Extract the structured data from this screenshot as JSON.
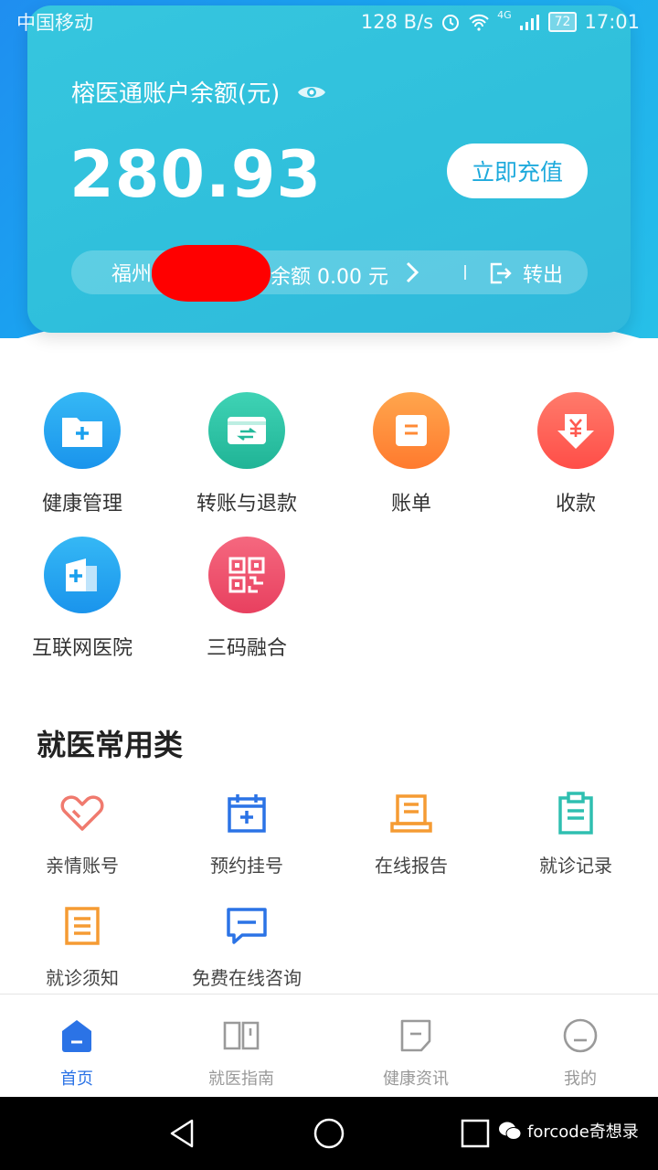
{
  "status_bar": {
    "carrier": "中国移动",
    "speed": "128 B/s",
    "battery": "72",
    "time": "17:01",
    "network": "4G"
  },
  "account": {
    "balance_label": "榕医通账户余额(元)",
    "balance": "280.93",
    "recharge_label": "立即充值",
    "sub_account_name": "福州",
    "sub_account_balance": "余额 0.00 元",
    "transfer_out_label": "转出"
  },
  "main_grid": [
    {
      "label": "健康管理",
      "icon": "health-folder-icon",
      "color": "#1aa4ef"
    },
    {
      "label": "转账与退款",
      "icon": "transfer-icon",
      "color": "#27c3a5"
    },
    {
      "label": "账单",
      "icon": "bill-icon",
      "color": "#ff8f3a"
    },
    {
      "label": "收款",
      "icon": "receive-yuan-icon",
      "color": "#ff5a52"
    },
    {
      "label": "互联网医院",
      "icon": "internet-hospital-icon",
      "color": "#1aa4ef"
    },
    {
      "label": "三码融合",
      "icon": "qr-code-icon",
      "color": "#ef4f6f"
    }
  ],
  "section": {
    "title": "就医常用类",
    "items": [
      {
        "label": "亲情账号",
        "icon": "heart-icon",
        "color": "#f07a6e"
      },
      {
        "label": "预约挂号",
        "icon": "calendar-icon",
        "color": "#2b73e6"
      },
      {
        "label": "在线报告",
        "icon": "report-icon",
        "color": "#f59b33"
      },
      {
        "label": "就诊记录",
        "icon": "clipboard-icon",
        "color": "#2fbfb0"
      },
      {
        "label": "就诊须知",
        "icon": "notice-icon",
        "color": "#f59b33"
      },
      {
        "label": "免费在线咨询",
        "icon": "chat-icon",
        "color": "#2b73e6"
      }
    ]
  },
  "bottom_nav": [
    {
      "label": "首页",
      "active": true
    },
    {
      "label": "就医指南",
      "active": false
    },
    {
      "label": "健康资讯",
      "active": false
    },
    {
      "label": "我的",
      "active": false
    }
  ],
  "watermark": "forcode奇想录"
}
